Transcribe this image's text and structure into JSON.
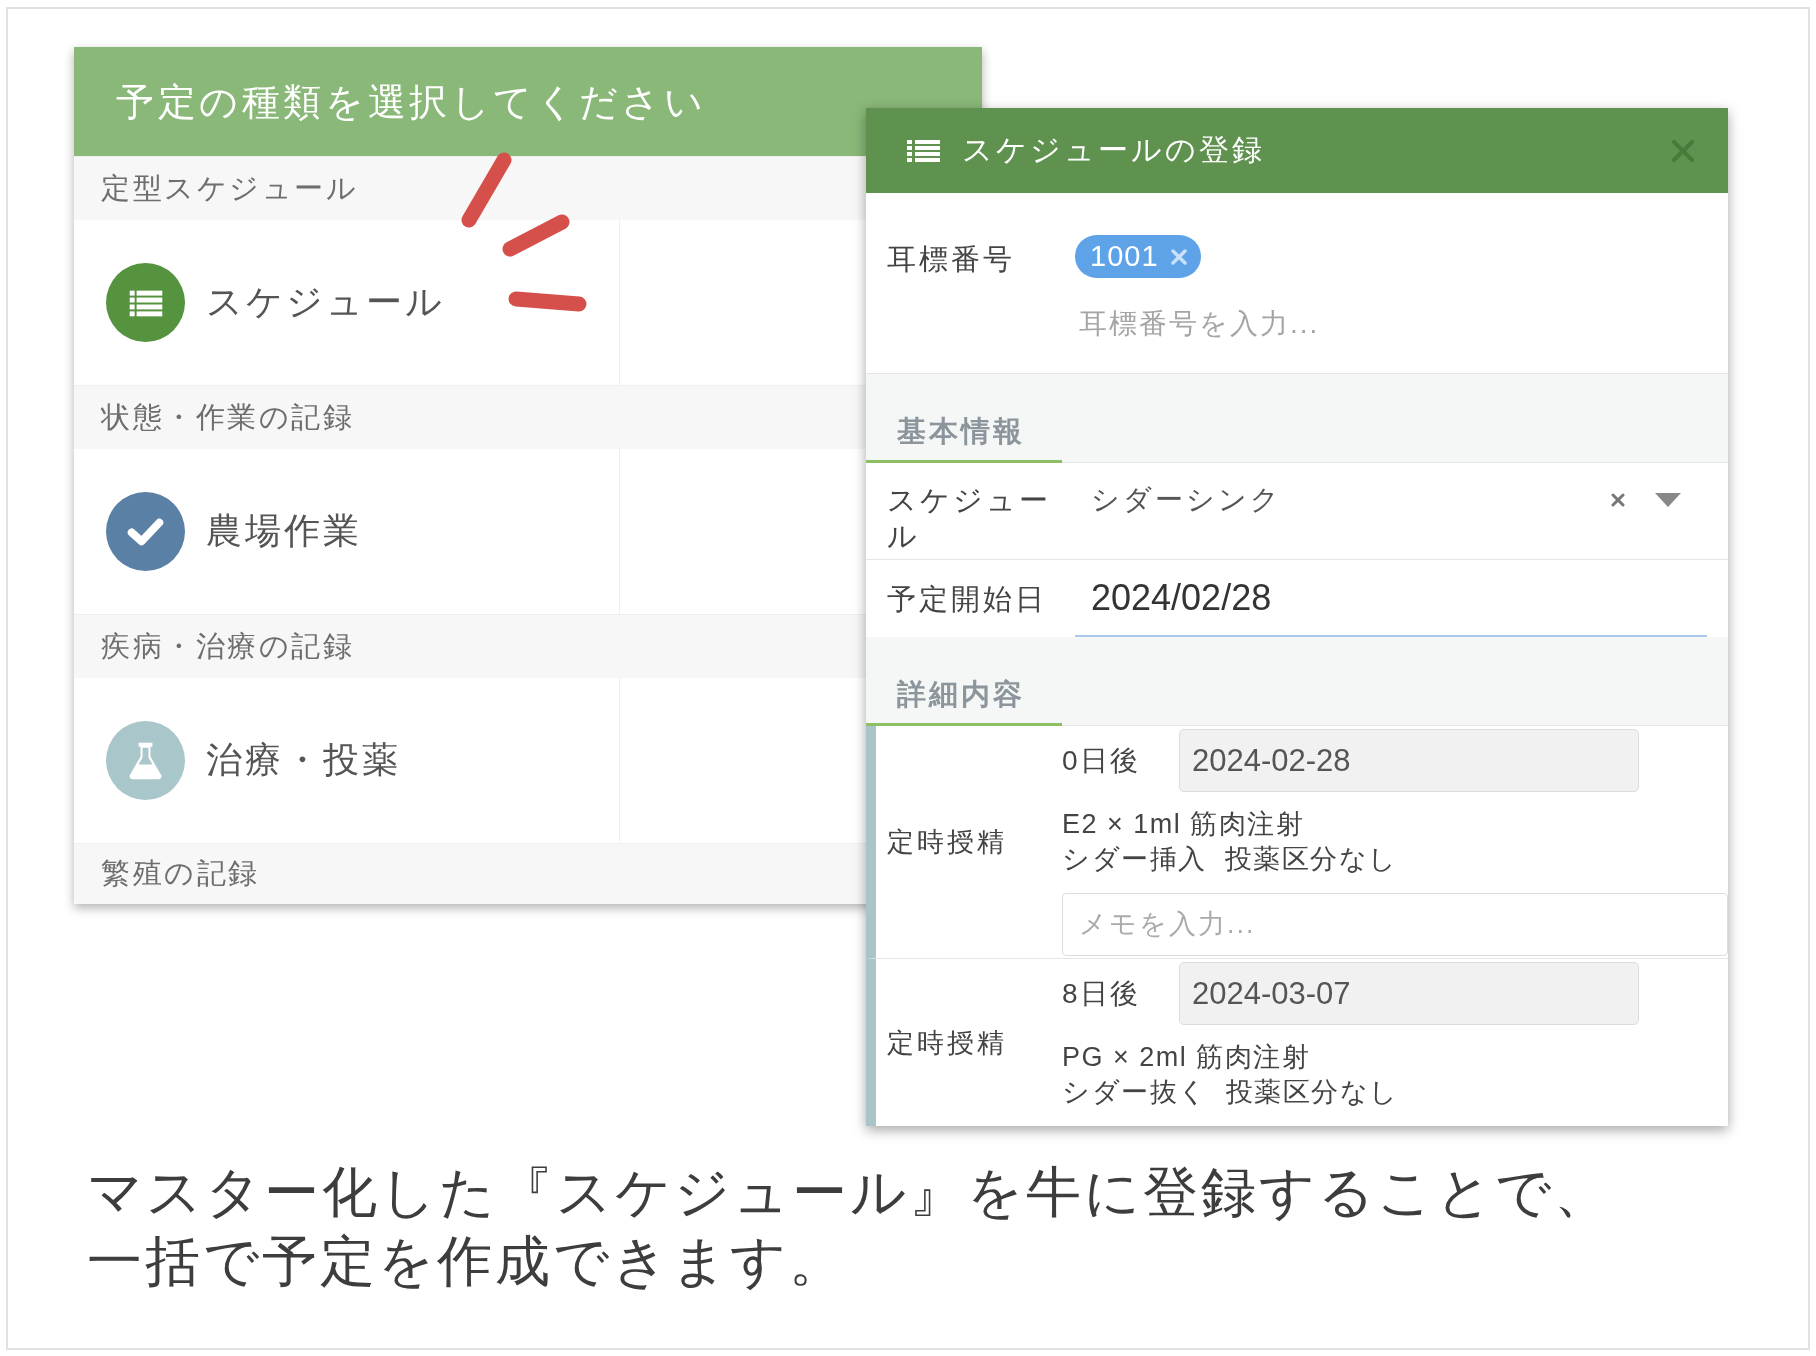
{
  "type_picker": {
    "title": "予定の種類を選択してください",
    "groups": [
      {
        "heading": "定型スケジュール",
        "items": [
          {
            "label": "スケジュール",
            "kind": "list"
          }
        ]
      },
      {
        "heading": "状態・作業の記録",
        "items": [
          {
            "label": "農場作業",
            "kind": "check"
          }
        ]
      },
      {
        "heading": "疾病・治療の記録",
        "items": [
          {
            "label": "治療・投薬",
            "kind": "flask"
          }
        ]
      },
      {
        "heading": "繁殖の記録"
      }
    ]
  },
  "schedule_dialog": {
    "title": "スケジュールの登録",
    "ear_tag": {
      "label": "耳標番号",
      "tags": [
        "1001"
      ],
      "placeholder": "耳標番号を入力..."
    },
    "sections": [
      {
        "title": "基本情報",
        "fields": [
          {
            "label": "スケジュール",
            "kind": "select",
            "value": "シダーシンク"
          },
          {
            "label": "予定開始日",
            "kind": "date",
            "value": "2024/02/28"
          }
        ]
      },
      {
        "title": "詳細内容",
        "steps": [
          {
            "label": "定時授精",
            "offset": "0日後",
            "date": "2024-02-28",
            "dose": "E2 × 1ml 筋肉注射",
            "note": "シダー挿入  投薬区分なし",
            "memo_placeholder": "メモを入力..."
          },
          {
            "label": "定時授精",
            "offset": "8日後",
            "date": "2024-03-07",
            "dose": "PG × 2ml 筋肉注射",
            "note": "シダー抜く  投薬区分なし"
          }
        ]
      }
    ]
  },
  "caption": "マスター化した『スケジュール』を牛に登録することで、一括で予定を作成できます。"
}
